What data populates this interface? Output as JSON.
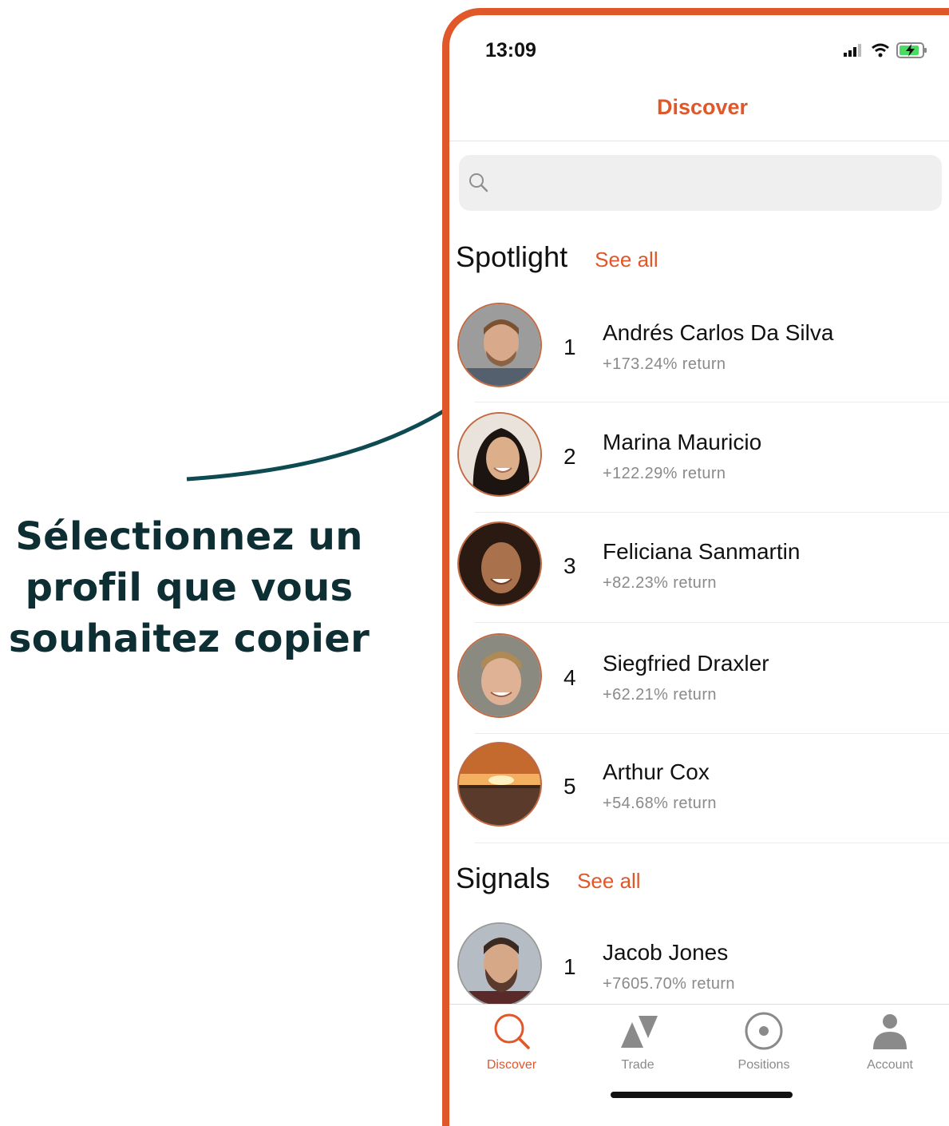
{
  "annotation": {
    "line1": "Sélectionnez un",
    "line2": "profil que vous",
    "line3": "souhaitez copier"
  },
  "status_bar": {
    "time": "13:09",
    "icons": [
      "signal-icon",
      "wifi-icon",
      "battery-charging-icon"
    ]
  },
  "header": {
    "title": "Discover"
  },
  "search": {
    "placeholder": ""
  },
  "spotlight": {
    "title": "Spotlight",
    "see_all": "See all",
    "items": [
      {
        "rank": "1",
        "name": "Andrés Carlos Da Silva",
        "return": "+173.24% return"
      },
      {
        "rank": "2",
        "name": "Marina Mauricio",
        "return": "+122.29% return"
      },
      {
        "rank": "3",
        "name": "Feliciana Sanmartin",
        "return": "+82.23% return"
      },
      {
        "rank": "4",
        "name": "Siegfried Draxler",
        "return": "+62.21% return"
      },
      {
        "rank": "5",
        "name": "Arthur Cox",
        "return": "+54.68% return"
      }
    ]
  },
  "signals": {
    "title": "Signals",
    "see_all": "See all",
    "items": [
      {
        "rank": "1",
        "name": "Jacob Jones",
        "return": "+7605.70% return"
      }
    ]
  },
  "tabbar": {
    "tabs": [
      {
        "label": "Discover",
        "icon": "search-icon",
        "active": true
      },
      {
        "label": "Trade",
        "icon": "trade-icon",
        "active": false
      },
      {
        "label": "Positions",
        "icon": "positions-icon",
        "active": false
      },
      {
        "label": "Account",
        "icon": "account-icon",
        "active": false
      }
    ]
  },
  "colors": {
    "accent": "#e0572a",
    "annotation": "#0d2e33",
    "secondary_text": "#8a8a8a"
  }
}
